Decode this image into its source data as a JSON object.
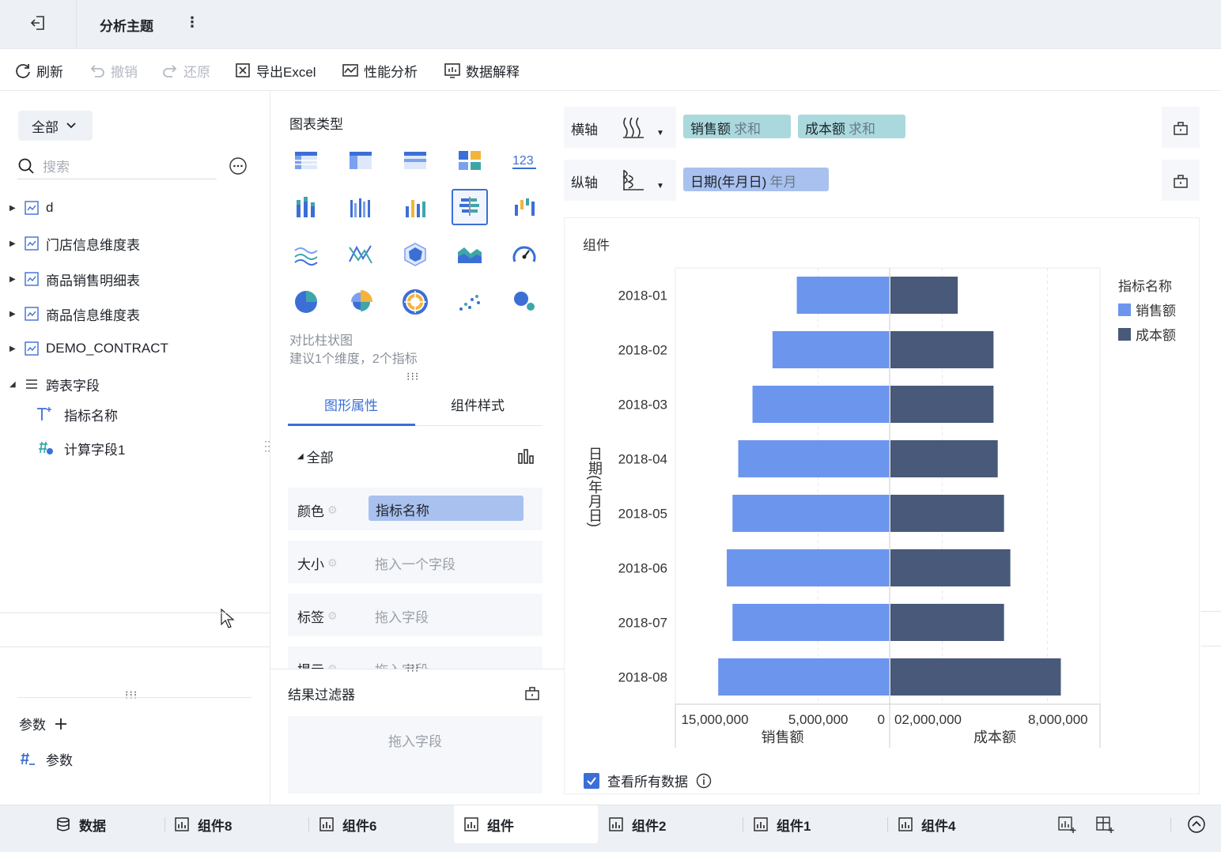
{
  "header": {
    "title": "分析主题",
    "more": "⋮"
  },
  "toolbar": {
    "refresh": "刷新",
    "undo": "撤销",
    "redo": "还原",
    "export_excel": "导出Excel",
    "performance": "性能分析",
    "data_explain": "数据解释"
  },
  "left": {
    "scope": "全部",
    "search_placeholder": "搜索",
    "tables": [
      "d",
      "门店信息维度表",
      "商品销售明细表",
      "商品信息维度表",
      "DEMO_CONTRACT"
    ],
    "cross_fields": "跨表字段",
    "sub_fields": [
      "指标名称",
      "计算字段1"
    ],
    "params_title": "参数",
    "param_item": "参数"
  },
  "middle": {
    "chart_type_label": "图表类型",
    "selected_chart_name": "对比柱状图",
    "selected_chart_hint": "建议1个维度，2个指标",
    "tabs": [
      "图形属性",
      "组件样式"
    ],
    "all_label": "全部",
    "props": [
      {
        "label": "颜色",
        "value": "指标名称"
      },
      {
        "label": "大小",
        "value": "拖入一个字段"
      },
      {
        "label": "标签",
        "value": "拖入字段"
      },
      {
        "label": "提示",
        "value": "拖入字段"
      }
    ],
    "filter_title": "结果过滤器",
    "filter_placeholder": "拖入字段"
  },
  "right": {
    "x_axis_label": "横轴",
    "y_axis_label": "纵轴",
    "x_fields": [
      {
        "name": "销售额",
        "agg": "求和"
      },
      {
        "name": "成本额",
        "agg": "求和"
      }
    ],
    "y_fields": [
      {
        "name": "日期(年月日)",
        "agg": "年月"
      }
    ],
    "card_title": "组件",
    "see_all": "查看所有数据"
  },
  "colors": {
    "sales": "#6c95ee",
    "cost": "#48597a",
    "accent": "#3c6fd6"
  },
  "chart_data": {
    "type": "bar",
    "orientation": "horizontal-butterfly",
    "categories": [
      "2018-01",
      "2018-02",
      "2018-03",
      "2018-04",
      "2018-05",
      "2018-06",
      "2018-07",
      "2018-08"
    ],
    "series": [
      {
        "name": "销售额",
        "values": [
          6500000,
          8200000,
          9600000,
          10600000,
          11000000,
          11400000,
          11000000,
          12000000
        ]
      },
      {
        "name": "成本额",
        "values": [
          3200000,
          4900000,
          4900000,
          5100000,
          5400000,
          5700000,
          5400000,
          8100000
        ]
      }
    ],
    "left_axis": {
      "label": "销售额",
      "ticks": [
        "15,000,000",
        "5,000,000",
        "0"
      ],
      "max": 15000000
    },
    "right_axis": {
      "label": "成本额",
      "ticks": [
        "0",
        "2,000,000",
        "8,000,000"
      ],
      "max": 10000000
    },
    "ylabel": "日期(年月日)",
    "legend_title": "指标名称",
    "legend_position": "top-right"
  },
  "bottom_tabs": [
    "数据",
    "组件8",
    "组件6",
    "组件",
    "组件2",
    "组件1",
    "组件4"
  ]
}
